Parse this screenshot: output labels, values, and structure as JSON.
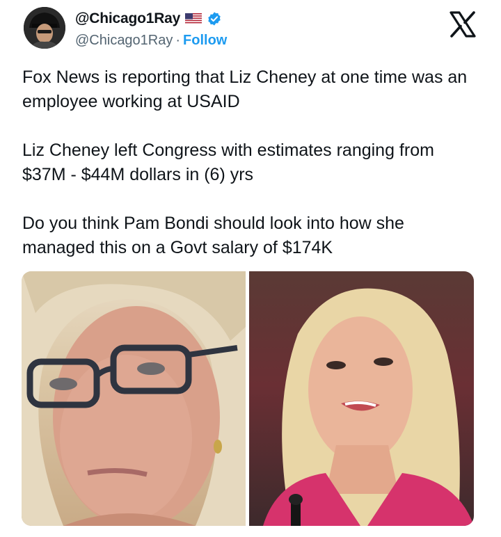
{
  "tweet": {
    "author": {
      "display_name": "@Chicago1Ray",
      "handle": "@Chicago1Ray",
      "separator": "·",
      "follow_label": "Follow",
      "flag_icon": "us-flag-icon",
      "verified_icon": "verified-badge-icon"
    },
    "platform_icon": "x-logo-icon",
    "paragraphs": [
      "Fox News is reporting that Liz Cheney at one time was an employee working at USAID",
      "Liz Cheney left Congress with estimates ranging from $37M - $44M dollars in (6) yrs",
      "Do you think Pam Bondi should look into how she managed this on a Govt salary of $174K"
    ],
    "media": {
      "count": 2
    }
  },
  "colors": {
    "text": "#0f1419",
    "secondary_text": "#536471",
    "accent": "#1d9bf0",
    "verified": "#1d9bf0"
  }
}
